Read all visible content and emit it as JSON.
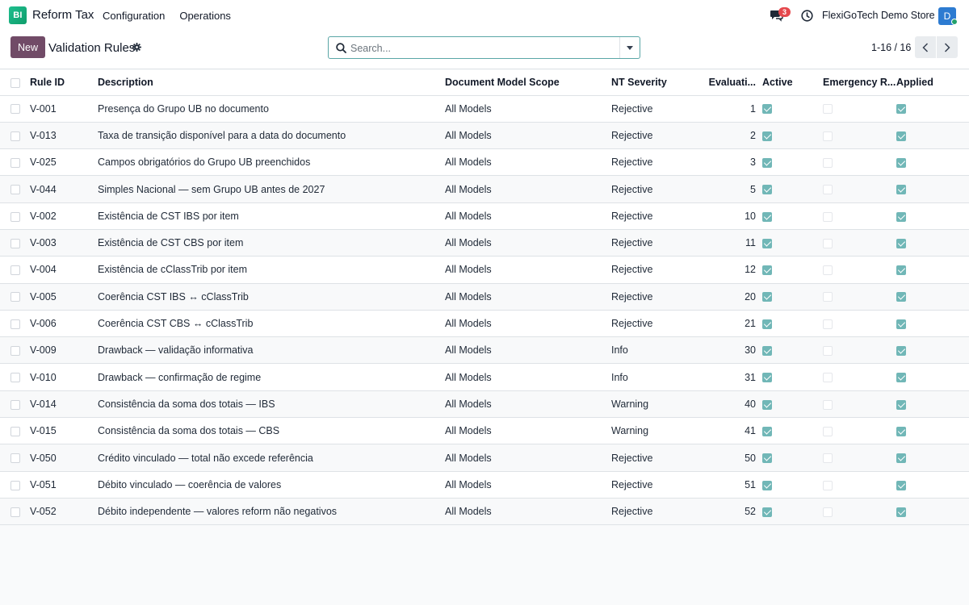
{
  "app": {
    "logo_text": "BI",
    "name": "Reform Tax",
    "brand_color": "#1fbf8f"
  },
  "nav": {
    "items": [
      "Configuration",
      "Operations"
    ]
  },
  "systray": {
    "chat_count": "3",
    "company": "FlexiGoTech Demo Store",
    "avatar_initial": "D"
  },
  "control": {
    "new_label": "New",
    "title": "Validation Rules",
    "search_placeholder": "Search...",
    "pager": "1-16 / 16",
    "accent_color": "#714b67"
  },
  "table": {
    "headers": {
      "rule_id": "Rule ID",
      "description": "Description",
      "scope": "Document Model Scope",
      "severity": "NT Severity",
      "evaluation": "Evaluati...",
      "active": "Active",
      "emergency": "Emergency R...",
      "applied": "Applied"
    },
    "rows": [
      {
        "rule_id": "V-001",
        "description": "Presença do Grupo UB no documento",
        "scope": "All Models",
        "severity": "Rejective",
        "evaluation": "1",
        "active": true,
        "emergency": false,
        "applied": true
      },
      {
        "rule_id": "V-013",
        "description": "Taxa de transição disponível para a data do documento",
        "scope": "All Models",
        "severity": "Rejective",
        "evaluation": "2",
        "active": true,
        "emergency": false,
        "applied": true
      },
      {
        "rule_id": "V-025",
        "description": "Campos obrigatórios do Grupo UB preenchidos",
        "scope": "All Models",
        "severity": "Rejective",
        "evaluation": "3",
        "active": true,
        "emergency": false,
        "applied": true
      },
      {
        "rule_id": "V-044",
        "description": "Simples Nacional — sem Grupo UB antes de 2027",
        "scope": "All Models",
        "severity": "Rejective",
        "evaluation": "5",
        "active": true,
        "emergency": false,
        "applied": true
      },
      {
        "rule_id": "V-002",
        "description": "Existência de CST IBS por item",
        "scope": "All Models",
        "severity": "Rejective",
        "evaluation": "10",
        "active": true,
        "emergency": false,
        "applied": true
      },
      {
        "rule_id": "V-003",
        "description": "Existência de CST CBS por item",
        "scope": "All Models",
        "severity": "Rejective",
        "evaluation": "11",
        "active": true,
        "emergency": false,
        "applied": true
      },
      {
        "rule_id": "V-004",
        "description": "Existência de cClassTrib por item",
        "scope": "All Models",
        "severity": "Rejective",
        "evaluation": "12",
        "active": true,
        "emergency": false,
        "applied": true
      },
      {
        "rule_id": "V-005",
        "description": "Coerência CST IBS ↔ cClassTrib",
        "scope": "All Models",
        "severity": "Rejective",
        "evaluation": "20",
        "active": true,
        "emergency": false,
        "applied": true
      },
      {
        "rule_id": "V-006",
        "description": "Coerência CST CBS ↔ cClassTrib",
        "scope": "All Models",
        "severity": "Rejective",
        "evaluation": "21",
        "active": true,
        "emergency": false,
        "applied": true
      },
      {
        "rule_id": "V-009",
        "description": "Drawback — validação informativa",
        "scope": "All Models",
        "severity": "Info",
        "evaluation": "30",
        "active": true,
        "emergency": false,
        "applied": true
      },
      {
        "rule_id": "V-010",
        "description": "Drawback — confirmação de regime",
        "scope": "All Models",
        "severity": "Info",
        "evaluation": "31",
        "active": true,
        "emergency": false,
        "applied": true
      },
      {
        "rule_id": "V-014",
        "description": "Consistência da soma dos totais — IBS",
        "scope": "All Models",
        "severity": "Warning",
        "evaluation": "40",
        "active": true,
        "emergency": false,
        "applied": true
      },
      {
        "rule_id": "V-015",
        "description": "Consistência da soma dos totais — CBS",
        "scope": "All Models",
        "severity": "Warning",
        "evaluation": "41",
        "active": true,
        "emergency": false,
        "applied": true
      },
      {
        "rule_id": "V-050",
        "description": "Crédito vinculado — total não excede referência",
        "scope": "All Models",
        "severity": "Rejective",
        "evaluation": "50",
        "active": true,
        "emergency": false,
        "applied": true
      },
      {
        "rule_id": "V-051",
        "description": "Débito vinculado — coerência de valores",
        "scope": "All Models",
        "severity": "Rejective",
        "evaluation": "51",
        "active": true,
        "emergency": false,
        "applied": true
      },
      {
        "rule_id": "V-052",
        "description": "Débito independente — valores reform não negativos",
        "scope": "All Models",
        "severity": "Rejective",
        "evaluation": "52",
        "active": true,
        "emergency": false,
        "applied": true
      }
    ]
  }
}
